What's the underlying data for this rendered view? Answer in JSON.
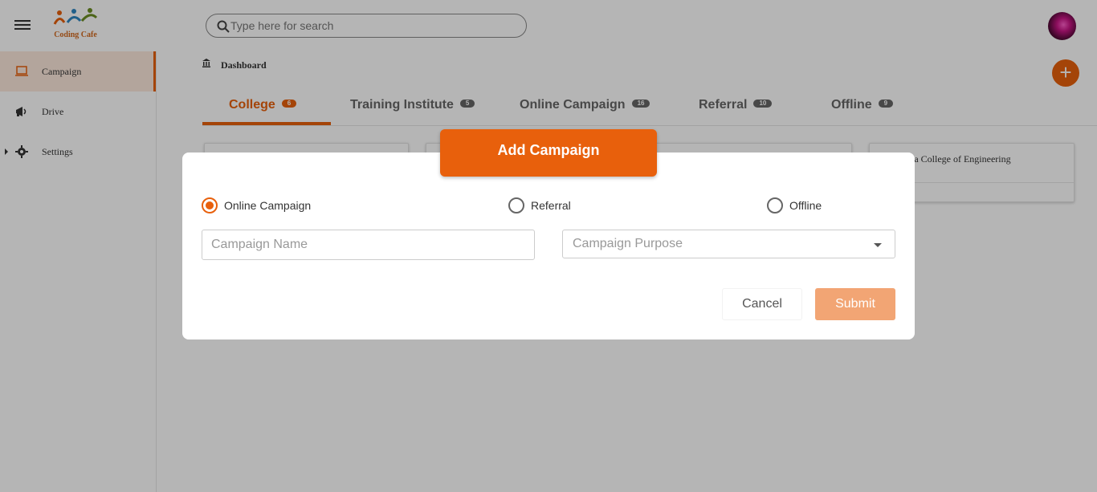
{
  "app": {
    "logo_text": "Coding Cafe"
  },
  "header": {
    "search_placeholder": "Type here for search"
  },
  "sidebar": {
    "items": [
      {
        "label": "Campaign"
      },
      {
        "label": "Drive"
      },
      {
        "label": "Settings"
      }
    ]
  },
  "breadcrumb": {
    "label": "Dashboard"
  },
  "tabs": [
    {
      "label": "College",
      "count": "6"
    },
    {
      "label": "Training Institute",
      "count": "5"
    },
    {
      "label": "Online Campaign",
      "count": "16"
    },
    {
      "label": "Referral",
      "count": "10"
    },
    {
      "label": "Offline",
      "count": "9"
    }
  ],
  "cards": [
    {
      "title": ""
    },
    {
      "title": ""
    },
    {
      "title": ""
    },
    {
      "title": "iya College of Engineering"
    }
  ],
  "dialog": {
    "title": "Add Campaign",
    "radios": [
      {
        "label": "Online Campaign",
        "checked": true
      },
      {
        "label": "Referral",
        "checked": false
      },
      {
        "label": "Offline",
        "checked": false
      }
    ],
    "campaign_name_placeholder": "Campaign Name",
    "campaign_purpose_placeholder": "Campaign Purpose",
    "cancel_label": "Cancel",
    "submit_label": "Submit"
  },
  "colors": {
    "accent": "#e8600c",
    "submit_disabled": "#f2a574"
  }
}
